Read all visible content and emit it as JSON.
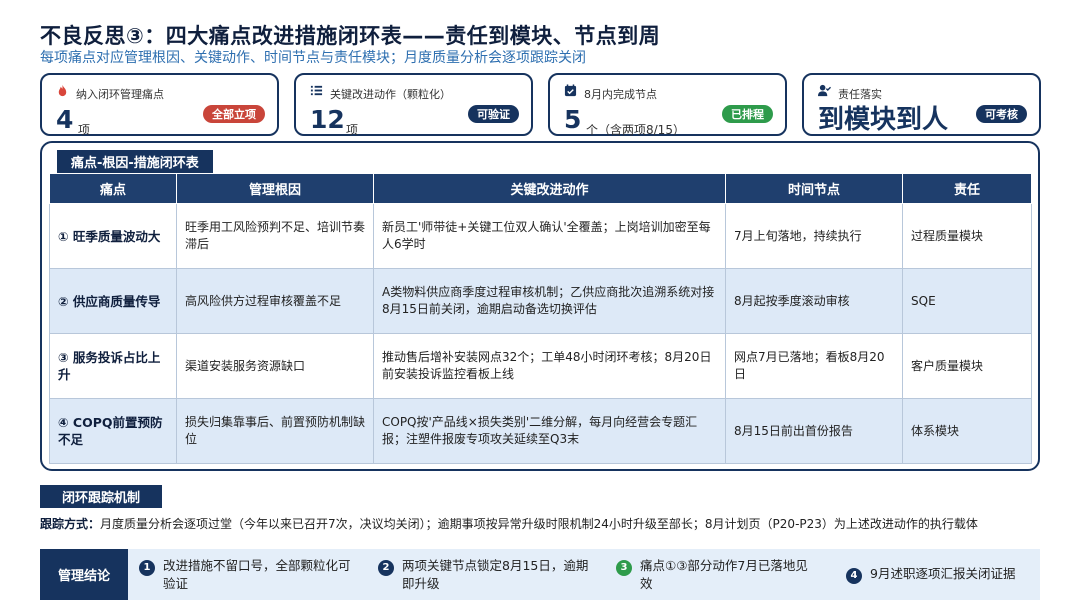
{
  "header": {
    "title": "不良反思③：四大痛点改进措施闭环表——责任到模块、节点到周",
    "subtitle": "每项痛点对应管理根因、关键动作、时间节点与责任模块；月度质量分析会逐项跟踪关闭"
  },
  "cards": [
    {
      "label": "纳入闭环管理痛点",
      "number": "4",
      "unit": "项",
      "badge": "全部立项",
      "badge_color": "#c9453a",
      "icon": "flame-icon"
    },
    {
      "label": "关键改进动作（颗粒化）",
      "number": "12",
      "unit": "项",
      "badge": "可验证",
      "badge_color": "#16335e",
      "icon": "list-icon"
    },
    {
      "label": "8月内完成节点",
      "number": "5",
      "unit": "个（含两项8/15）",
      "badge": "已排程",
      "badge_color": "#2e9b4b",
      "icon": "calendar-check-icon"
    },
    {
      "label": "责任落实",
      "big": "到模块到人",
      "badge": "可考核",
      "badge_color": "#16335e",
      "icon": "user-check-icon"
    }
  ],
  "table": {
    "section_label": "痛点-根因-措施闭环表",
    "headers": [
      "痛点",
      "管理根因",
      "关键改进动作",
      "时间节点",
      "责任"
    ],
    "rows": [
      {
        "pain": "① 旺季质量波动大",
        "cause": "旺季用工风险预判不足、培训节奏滞后",
        "action": "新员工'师带徒+关键工位双人确认'全覆盖；上岗培训加密至每人6学时",
        "timeline": "7月上旬落地，持续执行",
        "owner": "过程质量模块"
      },
      {
        "pain": "② 供应商质量传导",
        "cause": "高风险供方过程审核覆盖不足",
        "action": "A类物料供应商季度过程审核机制；乙供应商批次追溯系统对接8月15日前关闭，逾期启动备选切换评估",
        "timeline": "8月起按季度滚动审核",
        "owner": "SQE"
      },
      {
        "pain": "③ 服务投诉占比上升",
        "cause": "渠道安装服务资源缺口",
        "action": "推动售后增补安装网点32个；工单48小时闭环考核；8月20日前安装投诉监控看板上线",
        "timeline": "网点7月已落地；看板8月20日",
        "owner": "客户质量模块"
      },
      {
        "pain": "④ COPQ前置预防不足",
        "cause": "损失归集靠事后、前置预防机制缺位",
        "action": "COPQ按'产品线×损失类别'二维分解，每月向经营会专题汇报；注塑件报废专项攻关延续至Q3末",
        "timeline": "8月15日前出首份报告",
        "owner": "体系模块"
      }
    ]
  },
  "tracking": {
    "section_label": "闭环跟踪机制",
    "label": "跟踪方式：",
    "text": "月度质量分析会逐项过堂（今年以来已召开7次，决议均关闭）；逾期事项按异常升级时限机制24小时升级至部长；8月计划页（P20-P23）为上述改进动作的执行载体"
  },
  "conclusion": {
    "label": "管理结论",
    "items": [
      {
        "num": "1",
        "text": "改进措施不留口号，全部颗粒化可验证"
      },
      {
        "num": "2",
        "text": "两项关键节点锁定8月15日，逾期即升级"
      },
      {
        "num": "3",
        "text": "痛点①③部分动作7月已落地见效"
      },
      {
        "num": "4",
        "text": "9月述职逐项汇报关闭证据"
      }
    ]
  }
}
